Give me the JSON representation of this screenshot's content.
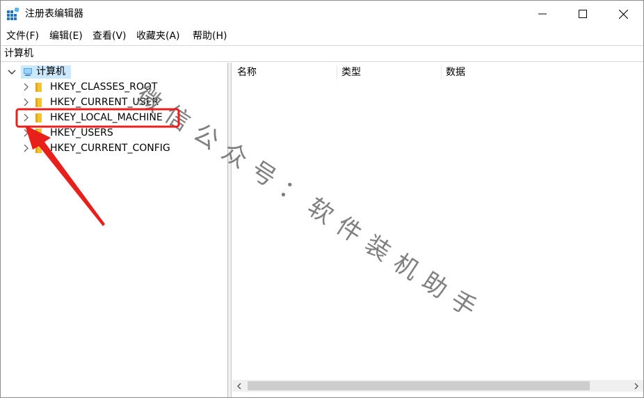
{
  "window": {
    "title": "注册表编辑器"
  },
  "menu": [
    "文件(F)",
    "编辑(E)",
    "查看(V)",
    "收藏夹(A)",
    "帮助(H)"
  ],
  "address": "计算机",
  "tree": {
    "root": "计算机",
    "items": [
      "HKEY_CLASSES_ROOT",
      "HKEY_CURRENT_USER",
      "HKEY_LOCAL_MACHINE",
      "HKEY_USERS",
      "HKEY_CURRENT_CONFIG"
    ]
  },
  "list": {
    "columns": [
      "名称",
      "类型",
      "数据"
    ]
  },
  "watermark": "微信公众号：软件装机助手",
  "colors": {
    "annotation": "#e8201c",
    "selection": "#cce8ff",
    "folder": "#f4c430"
  }
}
